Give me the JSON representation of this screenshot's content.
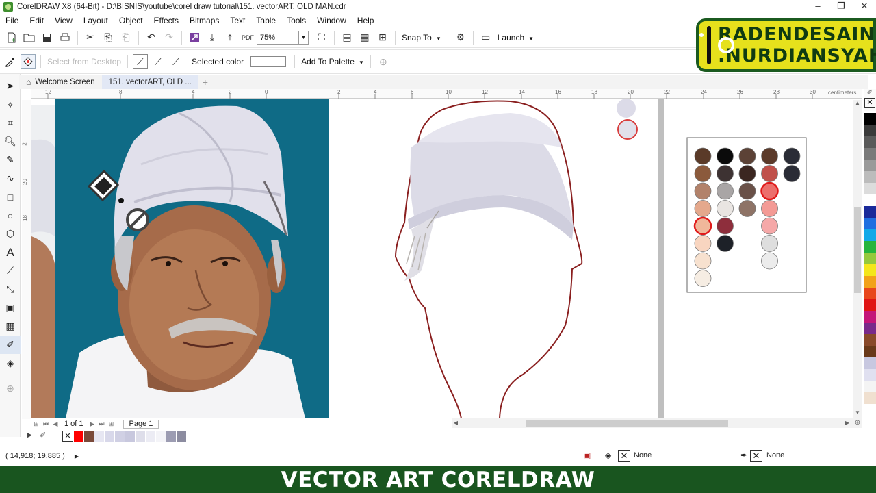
{
  "window": {
    "title": "CorelDRAW X8 (64-Bit) - D:\\BISNIS\\youtube\\corel draw tutorial\\151. vectorART, OLD MAN.cdr",
    "controls": [
      "–",
      "❐",
      "✕"
    ]
  },
  "menu": [
    "File",
    "Edit",
    "View",
    "Layout",
    "Object",
    "Effects",
    "Bitmaps",
    "Text",
    "Table",
    "Tools",
    "Window",
    "Help"
  ],
  "toolbar": {
    "zoom": "75%",
    "snap_to": "Snap To",
    "launch": "Launch"
  },
  "property_bar": {
    "select_from_desktop": "Select from Desktop",
    "selected_color_label": "Selected color",
    "add_to_palette": "Add To Palette"
  },
  "tabs": {
    "welcome": "Welcome Screen",
    "document": "151. vectorART, OLD ..."
  },
  "ruler": {
    "h_ticks": [
      "12",
      "8",
      "4",
      "2",
      "0",
      "2",
      "4",
      "6",
      "10",
      "12",
      "14",
      "16",
      "18",
      "20",
      "22",
      "24",
      "26",
      "28",
      "30"
    ],
    "units": "centimeters",
    "v_ticks": [
      "2",
      "20",
      "18"
    ]
  },
  "pages": {
    "counter": "1 of 1",
    "page_tab": "Page 1"
  },
  "status": {
    "coordinates": "( 14,918; 19,885 )",
    "fill": "None",
    "outline": "None"
  },
  "brand": {
    "line1": "RADENDESAIN",
    "line2": ".NURDIANSYAH"
  },
  "footer": "VECTOR ART CORELDRAW",
  "colors": {
    "footer_bg": "#19551f",
    "brand_bg": "#e6e11c",
    "outline": "#8a1f1f",
    "photo_bg": "#0f6b86",
    "turban": "#e1e0eb"
  },
  "skin_palette": [
    [
      "#5a3a28",
      "#0b0b0b",
      "#5c4236",
      "#5b3a2a",
      "#2a2c36"
    ],
    [
      "#8b5a3c",
      "#3d3232",
      "#3b2620",
      "#c0504a",
      "#2a2c36"
    ],
    [
      "#b2826a",
      "#a9a5a5",
      "#6a5148",
      "#ec6f6c",
      ""
    ],
    [
      "#e4a88c",
      "#e9e5e2",
      "#8e7366",
      "#f39a95",
      ""
    ],
    [
      "#f0b79a",
      "#8e2e3c",
      "",
      "#f5a8a8",
      ""
    ],
    [
      "#f8d5c0",
      "#1d2128",
      "",
      "#dedede",
      ""
    ],
    [
      "#f7e1cf",
      "",
      "",
      "#ececec",
      ""
    ],
    [
      "#f6ede3",
      "",
      "",
      "",
      ""
    ]
  ],
  "right_palette": [
    "#000000",
    "#3a3a3a",
    "#5a5a5a",
    "#7a7a7a",
    "#9a9a9a",
    "#bcbcbc",
    "#dcdcdc",
    "#ffffff",
    "#1a2a9a",
    "#1f6fe0",
    "#12a9e8",
    "#26b53e",
    "#95c93d",
    "#f4e61c",
    "#f2a21a",
    "#e8471c",
    "#e01515",
    "#c4167a",
    "#7a2a8a",
    "#8a4a2a",
    "#6a3a1a",
    "#c8c8e0",
    "#e0e0f0",
    "#f4f4f4",
    "#f0e0d0"
  ],
  "bottom_palette": [
    "#ff0000",
    "#7a4a3a",
    "#e6e6f2",
    "#d8d8ea",
    "#d0d0e4",
    "#c8c8de",
    "#dedeea",
    "#ececf4",
    "#f4f4f8",
    "#9c9cb2",
    "#8c8ca0"
  ]
}
